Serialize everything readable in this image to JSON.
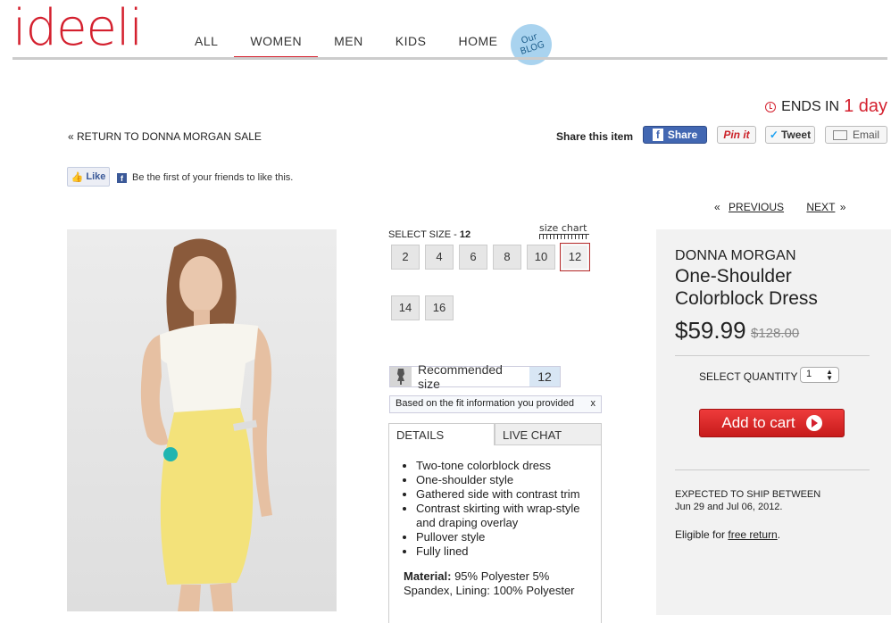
{
  "header": {
    "logo": "ideeli",
    "nav": [
      "ALL",
      "WOMEN",
      "MEN",
      "KIDS",
      "HOME"
    ],
    "active_nav": "WOMEN",
    "blog_badge": [
      "Our",
      "BLOG"
    ]
  },
  "sale": {
    "ends_prefix": "ENDS IN",
    "ends_value": "1 day",
    "return_link": "« RETURN TO DONNA MORGAN SALE"
  },
  "share": {
    "label": "Share this item",
    "facebook": "Share",
    "pinterest": "Pin it",
    "twitter": "Tweet",
    "email": "Email"
  },
  "facebook_like": {
    "button": "Like",
    "text": "Be the first of your friends to like this."
  },
  "pager": {
    "previous": "PREVIOUS",
    "next": "NEXT",
    "prev_arrow": "«",
    "next_arrow": "»"
  },
  "size": {
    "label": "SELECT SIZE - ",
    "selected": "12",
    "chart_label": "size chart",
    "options": [
      "2",
      "4",
      "6",
      "8",
      "10",
      "12",
      "14",
      "16"
    ]
  },
  "recommendation": {
    "label": "Recommended size",
    "value": "12",
    "note": "Based on the fit information you provided",
    "close": "x"
  },
  "tabs": [
    "DETAILS",
    "LIVE CHAT"
  ],
  "details": {
    "bullets": [
      "Two-tone colorblock dress",
      "One-shoulder style",
      "Gathered side with contrast trim",
      "Contrast skirting with wrap-style and draping overlay",
      "Pullover style",
      "Fully lined"
    ],
    "material_label": "Material:",
    "material_text": " 95% Polyester 5% Spandex, Lining: 100% Polyester"
  },
  "product": {
    "brand": "DONNA MORGAN",
    "name": "One-Shoulder Colorblock Dress",
    "price": "$59.99",
    "old_price": "$128.00",
    "quantity_label": "SELECT QUANTITY",
    "quantity": "1",
    "add_to_cart": "Add to cart",
    "ship_line1": "EXPECTED TO SHIP BETWEEN",
    "ship_line2": "Jun 29 and Jul 06, 2012.",
    "return_prefix": "Eligible for ",
    "return_link": "free return",
    "return_suffix": "."
  },
  "colors": {
    "brand_red": "#d4202e",
    "dress_top": "#f7f5ee",
    "dress_skirt": "#f3e27a"
  }
}
